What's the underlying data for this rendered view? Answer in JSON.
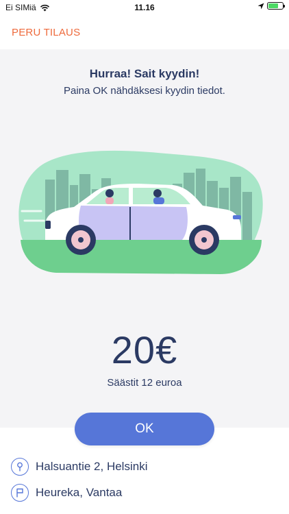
{
  "status_bar": {
    "carrier": "Ei SIMiä",
    "time": "11.16"
  },
  "header": {
    "cancel_label": "PERU TILAUS"
  },
  "main": {
    "headline": "Hurraa! Sait kyydin!",
    "subline": "Paina OK nähdäksesi kyydin tiedot.",
    "price": "20€",
    "savings": "Säästit 12 euroa",
    "ok_label": "OK"
  },
  "route": {
    "origin": "Halsuantie 2, Helsinki",
    "destination": "Heureka, Vantaa"
  },
  "colors": {
    "accent": "#5676d8",
    "cancel": "#ee6a3c",
    "text": "#2b3a63",
    "background": "#f4f4f6"
  }
}
